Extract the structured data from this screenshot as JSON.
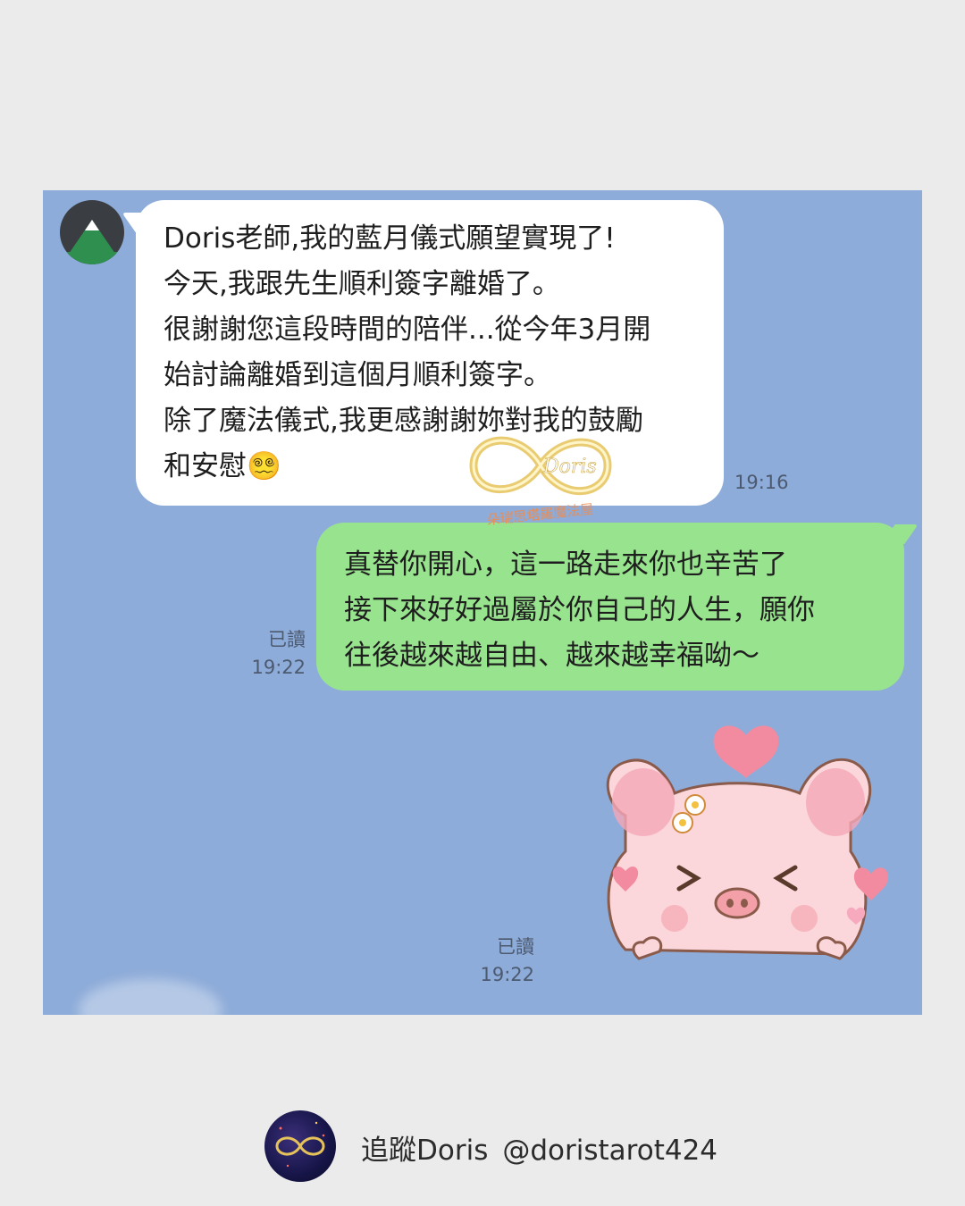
{
  "chat": {
    "incoming": {
      "lines": [
        "Doris老師,我的藍月儀式願望實現了!",
        "今天,我跟先生順利簽字離婚了。",
        "很謝謝您這段時間的陪伴...從今年3月開",
        "始討論離婚到這個月順利簽字。",
        "除了魔法儀式,我更感謝謝妳對我的鼓勵",
        "和安慰"
      ],
      "emoji": "😵‍💫",
      "time": "19:16"
    },
    "outgoing": {
      "lines": [
        "真替你開心，這一路走來你也辛苦了",
        "接下來好好過屬於你自己的人生，願你",
        "往後越來越自由、越來越幸福呦～"
      ],
      "read_label": "已讀",
      "time": "19:22"
    },
    "sticker": {
      "icon": "pig-sticker-icon",
      "read_label": "已讀",
      "time": "19:22"
    },
    "watermark": {
      "brand": "Doris",
      "subtitle": "朵瑞思塔羅魔法屋"
    }
  },
  "footer": {
    "follow_label": "追蹤Doris",
    "handle": "@doristarot424"
  },
  "colors": {
    "background": "#ebebeb",
    "chat_bg": "#8eacd9",
    "incoming_bubble": "#ffffff",
    "outgoing_bubble": "#98e48e"
  }
}
